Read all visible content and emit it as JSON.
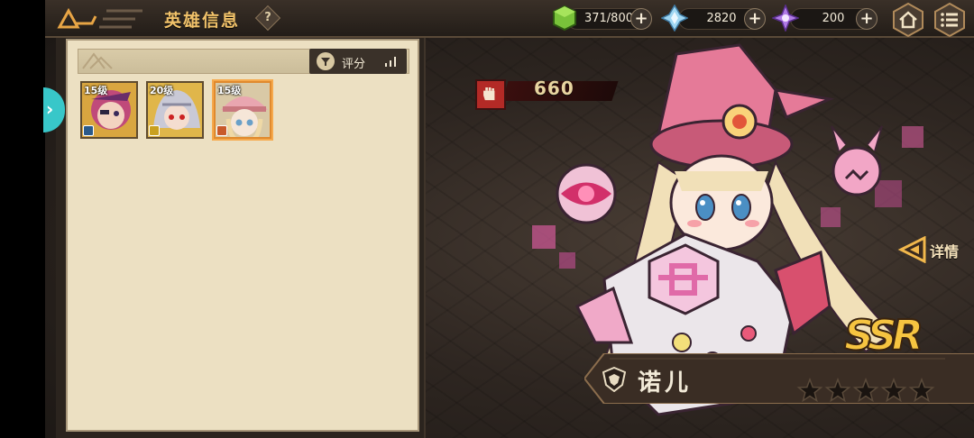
{
  "header": {
    "title": "英雄信息",
    "help_label": "?"
  },
  "resources": [
    {
      "name": "stamina",
      "value": "371/800",
      "icon": "green-cube-icon",
      "color": "#79c23a"
    },
    {
      "name": "crystal",
      "value": "2820",
      "icon": "blue-crystal-icon",
      "color": "#7fc3e8"
    },
    {
      "name": "gem",
      "value": "200",
      "icon": "purple-star-icon",
      "color": "#a66be0"
    }
  ],
  "nav": {
    "home_icon": "home-icon",
    "menu_icon": "menu-icon"
  },
  "hero_list": {
    "sort_label": "评分",
    "heroes": [
      {
        "level": "15级",
        "selected": false,
        "theme": "#c04a7a"
      },
      {
        "level": "20级",
        "selected": false,
        "theme": "#b8b8c8"
      },
      {
        "level": "15级",
        "selected": true,
        "theme": "#e9a6b0"
      }
    ]
  },
  "hero_detail": {
    "power": "660",
    "detail_label": "详情",
    "rarity": "SSR",
    "name": "诺儿",
    "stars": 5,
    "accent": "#e66f8f"
  }
}
